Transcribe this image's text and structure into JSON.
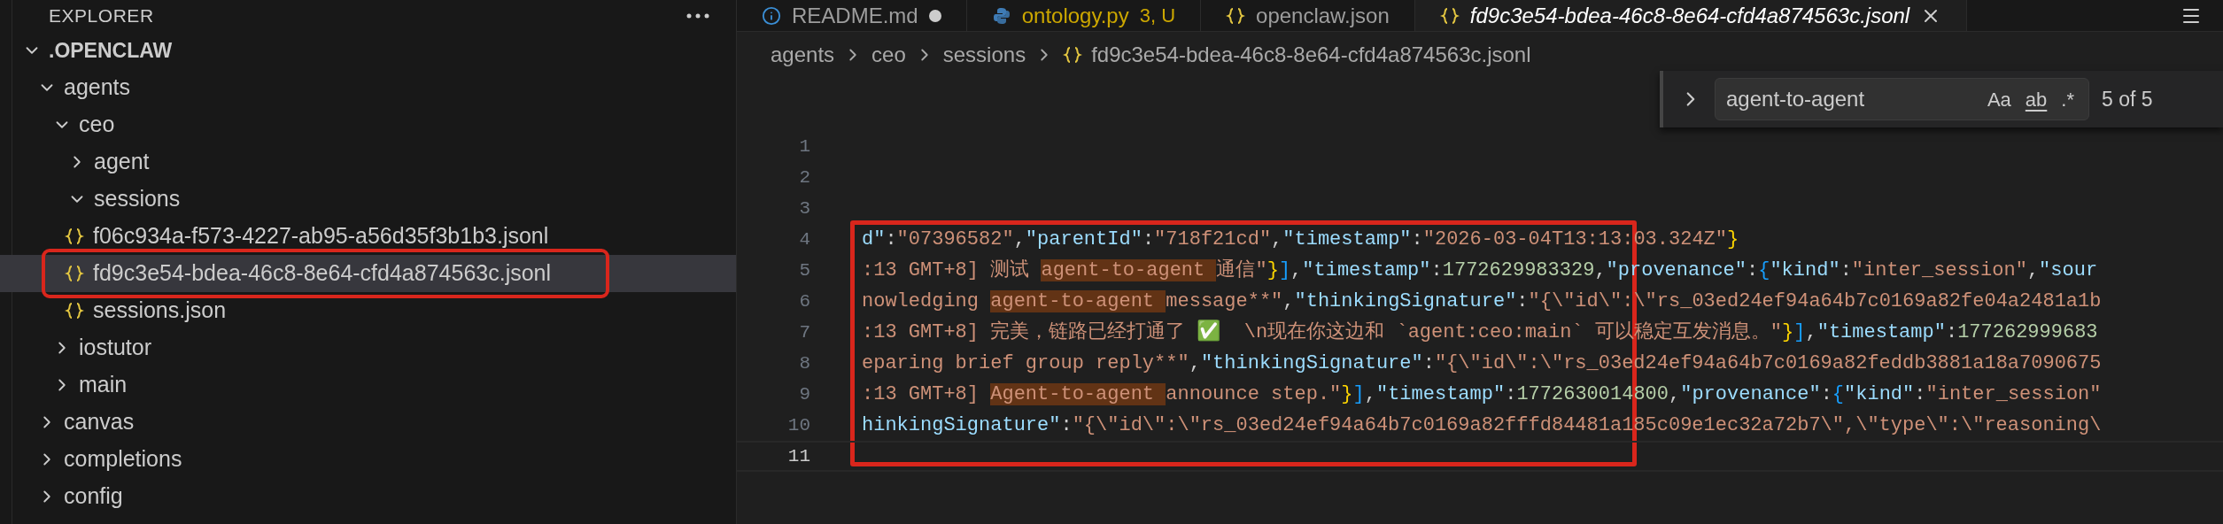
{
  "sidebar": {
    "title": "EXPLORER",
    "tree": [
      {
        "name": ".OPENCLAW",
        "kind": "root",
        "expanded": true,
        "selected": false,
        "children": [
          {
            "name": "agents",
            "kind": "folder",
            "expanded": true,
            "selected": false,
            "children": [
              {
                "name": "ceo",
                "kind": "folder",
                "expanded": true,
                "selected": false,
                "children": [
                  {
                    "name": "agent",
                    "kind": "folder",
                    "expanded": false,
                    "selected": false
                  },
                  {
                    "name": "sessions",
                    "kind": "folder",
                    "expanded": true,
                    "selected": false,
                    "children": [
                      {
                        "name": "f06c934a-f573-4227-ab95-a56d35f3b1b3.jsonl",
                        "kind": "file",
                        "selected": false,
                        "annotated": false
                      },
                      {
                        "name": "fd9c3e54-bdea-46c8-8e64-cfd4a874563c.jsonl",
                        "kind": "file",
                        "selected": true,
                        "annotated": true
                      },
                      {
                        "name": "sessions.json",
                        "kind": "file",
                        "selected": false,
                        "annotated": false
                      }
                    ]
                  }
                ]
              },
              {
                "name": "iostutor",
                "kind": "folder",
                "expanded": false,
                "selected": false
              },
              {
                "name": "main",
                "kind": "folder",
                "expanded": false,
                "selected": false
              }
            ]
          },
          {
            "name": "canvas",
            "kind": "folder",
            "expanded": false,
            "selected": false
          },
          {
            "name": "completions",
            "kind": "folder",
            "expanded": false,
            "selected": false
          },
          {
            "name": "config",
            "kind": "folder",
            "expanded": false,
            "selected": false
          }
        ]
      }
    ]
  },
  "tabs": [
    {
      "label": "README.md",
      "kind": "markdown",
      "selected": false,
      "modified": true
    },
    {
      "label": "ontology.py",
      "kind": "python",
      "selected": false,
      "modified": false,
      "badge": "3, U"
    },
    {
      "label": "openclaw.json",
      "kind": "json",
      "selected": false,
      "modified": false
    },
    {
      "label": "fd9c3e54-bdea-46c8-8e64-cfd4a874563c.jsonl",
      "kind": "json",
      "selected": true,
      "modified": false
    }
  ],
  "breadcrumb": [
    {
      "label": "agents",
      "kind": "folder"
    },
    {
      "label": "ceo",
      "kind": "folder"
    },
    {
      "label": "sessions",
      "kind": "folder"
    },
    {
      "label": "fd9c3e54-bdea-46c8-8e64-cfd4a874563c.jsonl",
      "kind": "json"
    }
  ],
  "find": {
    "query": "agent-to-agent",
    "result": "5 of 5",
    "options": [
      {
        "label": "Aa",
        "kind": "case",
        "on": false
      },
      {
        "label": "ab",
        "kind": "word",
        "on": false
      },
      {
        "label": ".*",
        "kind": "regex",
        "on": false
      }
    ]
  },
  "editor": {
    "lines": [
      {
        "number": "1",
        "current": false
      },
      {
        "number": "2",
        "current": false
      },
      {
        "number": "3",
        "current": false
      }
    ],
    "annotation": {
      "lines": [
        {
          "number": "4",
          "current": false,
          "tokens": [
            {
              "text": "d\"",
              "kind": "key"
            },
            {
              "text": ":",
              "kind": "punct"
            },
            {
              "text": "\"07396582\"",
              "kind": "string"
            },
            {
              "text": ",",
              "kind": "punct"
            },
            {
              "text": "\"parentId\"",
              "kind": "key"
            },
            {
              "text": ":",
              "kind": "punct"
            },
            {
              "text": "\"718f21cd\"",
              "kind": "string"
            },
            {
              "text": ",",
              "kind": "punct"
            },
            {
              "text": "\"timestamp\"",
              "kind": "key"
            },
            {
              "text": ":",
              "kind": "punct"
            },
            {
              "text": "\"2026-03-04T13:13:03.324Z\"",
              "kind": "string"
            },
            {
              "text": "}",
              "kind": "brace"
            }
          ]
        },
        {
          "number": "5",
          "current": false,
          "tokens": [
            {
              "text": ":13 GMT+8] 测试 ",
              "kind": "string"
            },
            {
              "text": "agent-to-agent ",
              "kind": "match"
            },
            {
              "text": "通信\"",
              "kind": "string"
            },
            {
              "text": "}",
              "kind": "brace"
            },
            {
              "text": "]",
              "kind": "bracket"
            },
            {
              "text": ",",
              "kind": "punct"
            },
            {
              "text": "\"timestamp\"",
              "kind": "key"
            },
            {
              "text": ":",
              "kind": "punct"
            },
            {
              "text": "1772629983329",
              "kind": "number"
            },
            {
              "text": ",",
              "kind": "punct"
            },
            {
              "text": "\"provenance\"",
              "kind": "key"
            },
            {
              "text": ":",
              "kind": "punct"
            },
            {
              "text": "{",
              "kind": "bracket"
            },
            {
              "text": "\"kind\"",
              "kind": "key"
            },
            {
              "text": ":",
              "kind": "punct"
            },
            {
              "text": "\"inter_session\"",
              "kind": "string"
            },
            {
              "text": ",",
              "kind": "punct"
            },
            {
              "text": "\"sour",
              "kind": "key"
            }
          ]
        },
        {
          "number": "6",
          "current": false,
          "tokens": [
            {
              "text": "nowledging ",
              "kind": "string"
            },
            {
              "text": "agent-to-agent ",
              "kind": "match"
            },
            {
              "text": "message**\"",
              "kind": "string"
            },
            {
              "text": ",",
              "kind": "punct"
            },
            {
              "text": "\"thinkingSignature\"",
              "kind": "key"
            },
            {
              "text": ":",
              "kind": "punct"
            },
            {
              "text": "\"{\\\"id\\\":\\\"rs_03ed24ef94a64b7c0169a82fe04a2481a1b",
              "kind": "string"
            }
          ]
        },
        {
          "number": "7",
          "current": false,
          "tokens": [
            {
              "text": ":13 GMT+8] 完美，链路已经打通了 ✅  \\n现在你这边和 `agent:ceo:main` 可以稳定互发消息。\"",
              "kind": "string"
            },
            {
              "text": "}",
              "kind": "brace"
            },
            {
              "text": "]",
              "kind": "bracket"
            },
            {
              "text": ",",
              "kind": "punct"
            },
            {
              "text": "\"timestamp\"",
              "kind": "key"
            },
            {
              "text": ":",
              "kind": "punct"
            },
            {
              "text": "177262999683",
              "kind": "number"
            }
          ]
        },
        {
          "number": "8",
          "current": false,
          "tokens": [
            {
              "text": "eparing brief group reply**\"",
              "kind": "string"
            },
            {
              "text": ",",
              "kind": "punct"
            },
            {
              "text": "\"thinkingSignature\"",
              "kind": "key"
            },
            {
              "text": ":",
              "kind": "punct"
            },
            {
              "text": "\"{\\\"id\\\":\\\"rs_03ed24ef94a64b7c0169a82feddb3881a18a7090675",
              "kind": "string"
            }
          ]
        },
        {
          "number": "9",
          "current": false,
          "tokens": [
            {
              "text": ":13 GMT+8] ",
              "kind": "string"
            },
            {
              "text": "Agent-to-agent ",
              "kind": "match"
            },
            {
              "text": "announce step.\"",
              "kind": "string"
            },
            {
              "text": "}",
              "kind": "brace"
            },
            {
              "text": "]",
              "kind": "bracket"
            },
            {
              "text": ",",
              "kind": "punct"
            },
            {
              "text": "\"timestamp\"",
              "kind": "key"
            },
            {
              "text": ":",
              "kind": "punct"
            },
            {
              "text": "1772630014800",
              "kind": "number"
            },
            {
              "text": ",",
              "kind": "punct"
            },
            {
              "text": "\"provenance\"",
              "kind": "key"
            },
            {
              "text": ":",
              "kind": "punct"
            },
            {
              "text": "{",
              "kind": "bracket"
            },
            {
              "text": "\"kind\"",
              "kind": "key"
            },
            {
              "text": ":",
              "kind": "punct"
            },
            {
              "text": "\"inter_session\"",
              "kind": "string"
            }
          ]
        },
        {
          "number": "10",
          "current": false,
          "tokens": [
            {
              "text": "hinkingSignature\"",
              "kind": "key"
            },
            {
              "text": ":",
              "kind": "punct"
            },
            {
              "text": "\"{\\\"id\\\":\\\"rs_03ed24ef94a64b7c0169a82fffd84481a185c09e1ec32a72b7\\\",\\\"type\\\":\\\"reasoning\\",
              "kind": "string"
            }
          ]
        },
        {
          "number": "11",
          "current": true
        }
      ]
    }
  }
}
